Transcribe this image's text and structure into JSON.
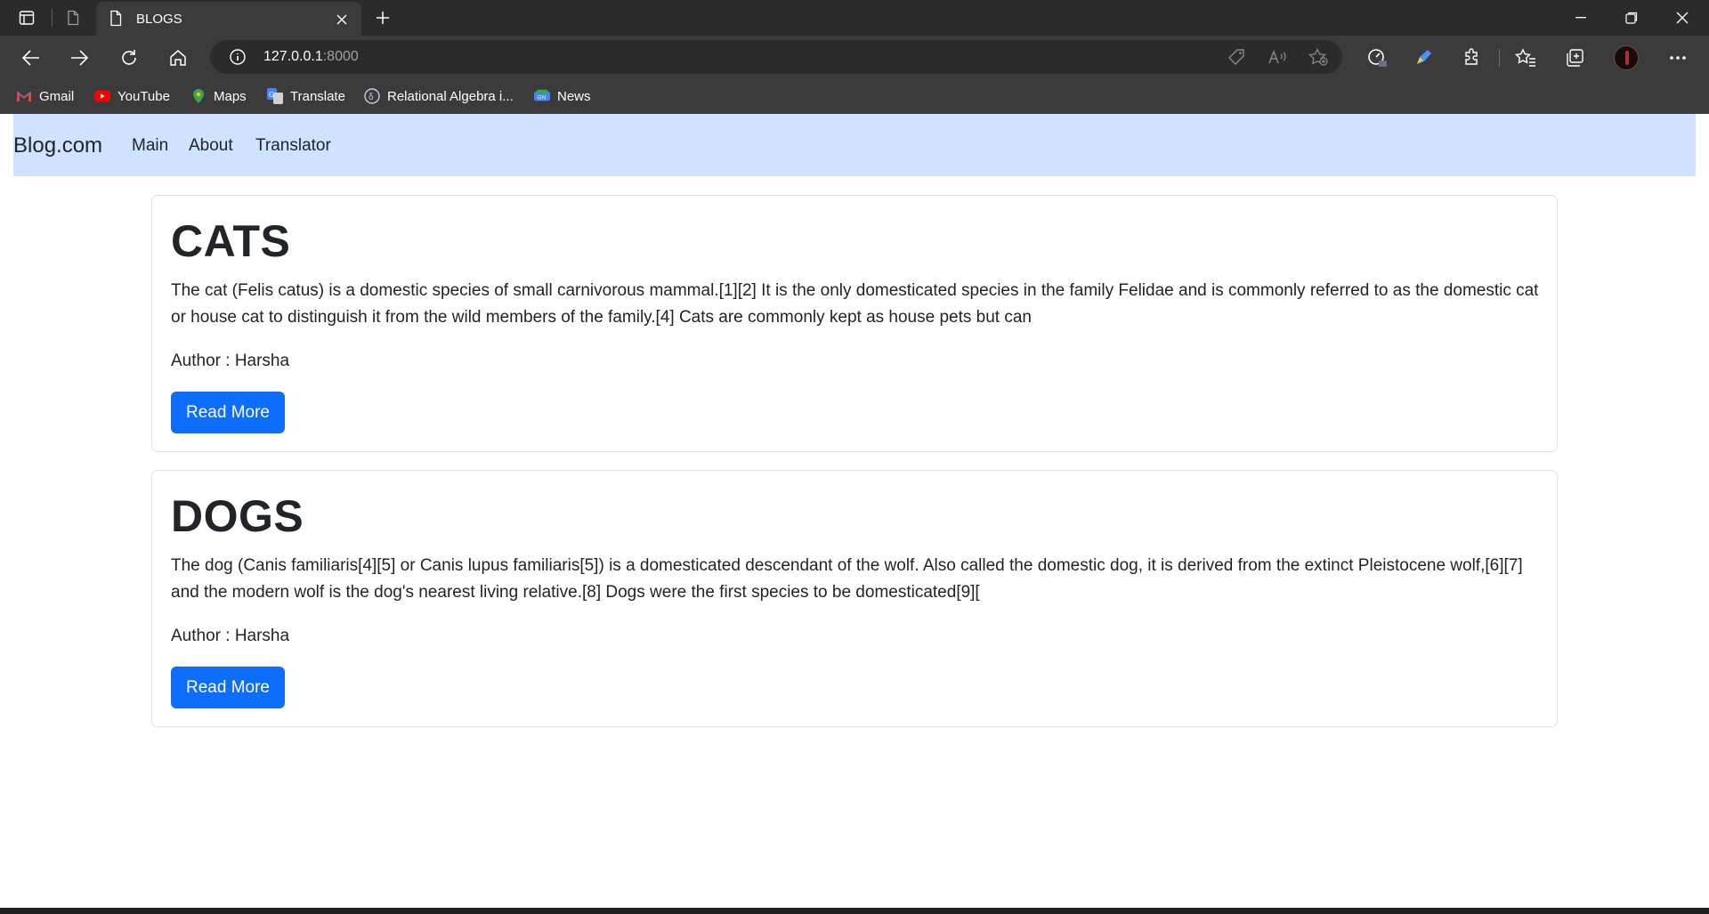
{
  "browser": {
    "tab_title": "BLOGS",
    "url_host": "127.0.0.1",
    "url_port": ":8000",
    "bookmarks": [
      {
        "label": "Gmail",
        "icon": "gmail-icon"
      },
      {
        "label": "YouTube",
        "icon": "youtube-icon"
      },
      {
        "label": "Maps",
        "icon": "maps-icon"
      },
      {
        "label": "Translate",
        "icon": "translate-icon"
      },
      {
        "label": "Relational Algebra i...",
        "icon": "relational-algebra-icon"
      },
      {
        "label": "News",
        "icon": "news-icon"
      }
    ]
  },
  "navbar": {
    "brand": "Blog.com",
    "links": [
      "Main",
      "About",
      "Translator"
    ]
  },
  "posts": [
    {
      "title": "CATS",
      "body": "The cat (Felis catus) is a domestic species of small carnivorous mammal.[1][2] It is the only domesticated species in the family Felidae and is commonly referred to as the domestic cat or house cat to distinguish it from the wild members of the family.[4] Cats are commonly kept as house pets but can",
      "author": "Author : Harsha",
      "button": "Read More"
    },
    {
      "title": "DOGS",
      "body": "The dog (Canis familiaris[4][5] or Canis lupus familiaris[5]) is a domesticated descendant of the wolf. Also called the domestic dog, it is derived from the extinct Pleistocene wolf,[6][7] and the modern wolf is the dog's nearest living relative.[8] Dogs were the first species to be domesticated[9][",
      "author": "Author : Harsha",
      "button": "Read More"
    }
  ],
  "colors": {
    "navbar_bg": "#cfe2ff",
    "button_primary": "#0d6efd",
    "chrome_dark": "#2b2b2b",
    "chrome_toolbar": "#3b3b3b"
  }
}
